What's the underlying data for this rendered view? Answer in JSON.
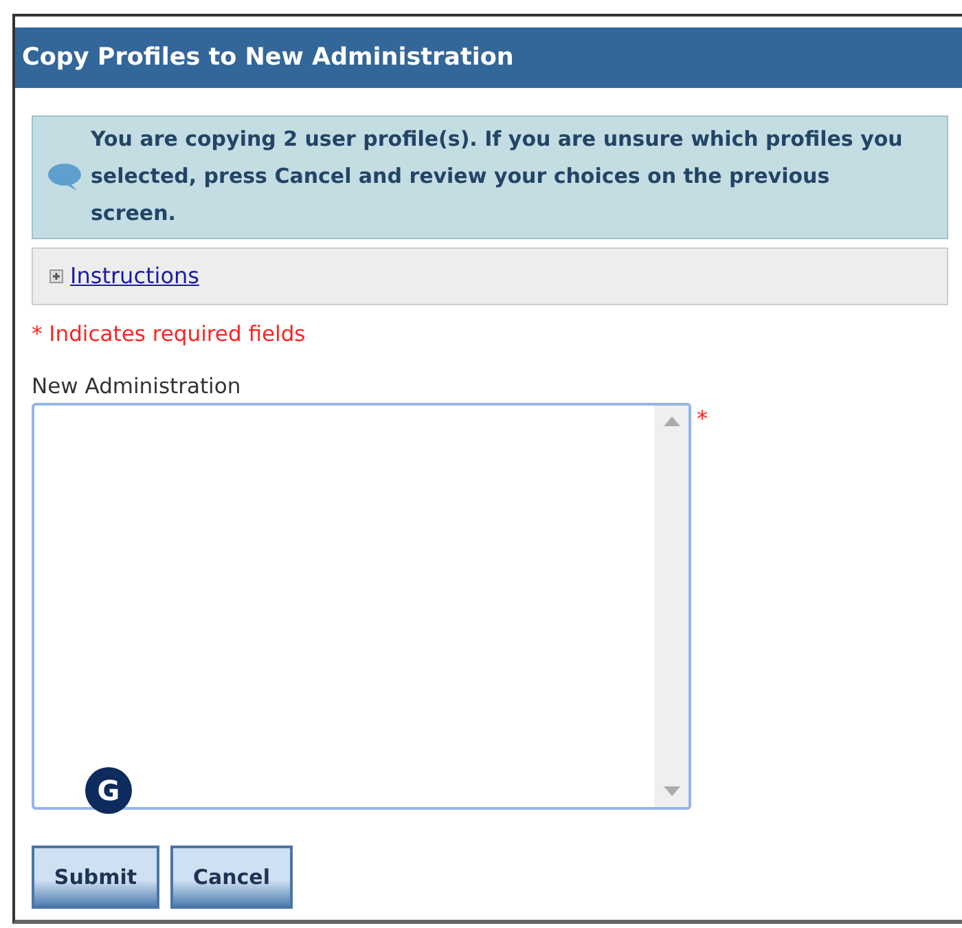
{
  "window": {
    "title": "Copy Profiles to New Administration"
  },
  "info_message": "You are copying 2 user profile(s). If you are unsure which profiles you selected, press Cancel and review your choices on the previous screen.",
  "instructions": {
    "label": "Instructions",
    "expanded": false
  },
  "required_note": "* Indicates required fields",
  "field": {
    "label": "New Administration",
    "required_mark": "*"
  },
  "callout": "G",
  "buttons": [
    "Submit",
    "Cancel"
  ]
}
